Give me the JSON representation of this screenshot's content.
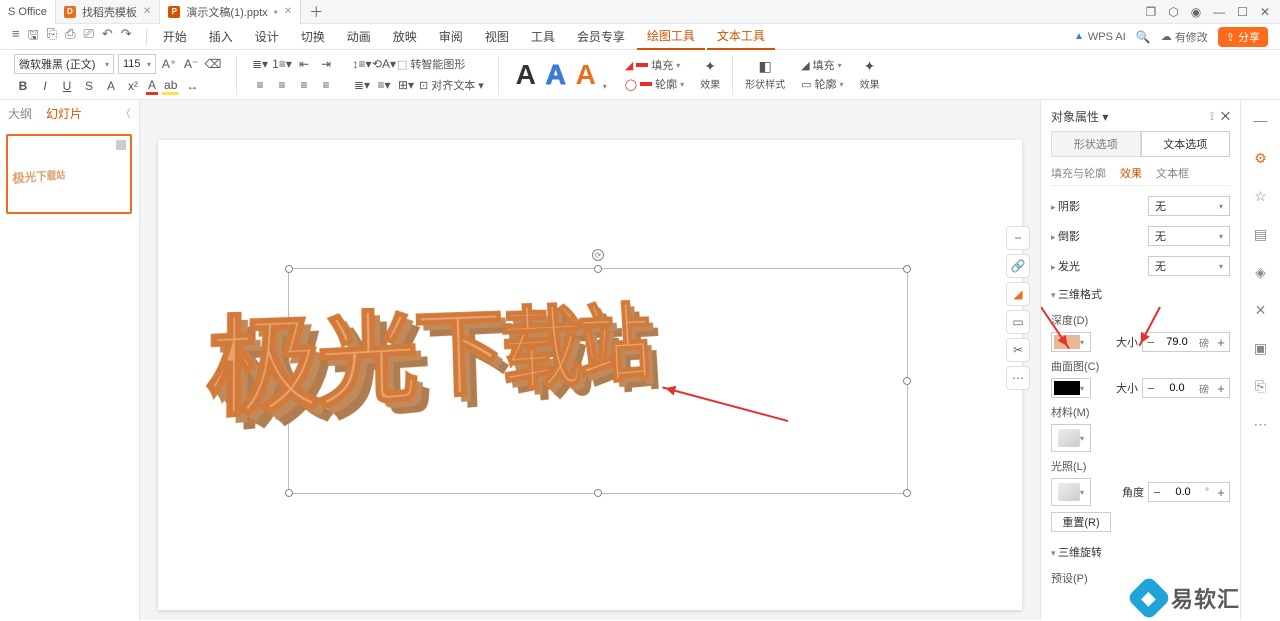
{
  "titlebar": {
    "office_tab": "S Office",
    "tab1": "找稻壳模板",
    "tab2": "演示文稿(1).pptx"
  },
  "window": {
    "changes": "有修改",
    "share": "分享"
  },
  "menus": [
    "开始",
    "插入",
    "设计",
    "切换",
    "动画",
    "放映",
    "审阅",
    "视图",
    "工具",
    "会员专享",
    "绘图工具",
    "文本工具"
  ],
  "wpsai": "WPS AI",
  "ribbon": {
    "font": "微软雅黑 (正文)",
    "size": "115",
    "convert": "转智能图形",
    "fit": "对齐文本",
    "fill": "填充",
    "outline": "轮廓",
    "effect": "效果",
    "shapestyle": "形状样式",
    "sfill": "填充",
    "soutline": "轮廓",
    "seffect": "效果"
  },
  "leftpanel": {
    "tab1": "大纲",
    "tab2": "幻灯片",
    "thumb_text": "极光下载站"
  },
  "canvas": {
    "text": "极光下载站"
  },
  "rightpanel": {
    "title": "对象属性",
    "tab_shape": "形状选项",
    "tab_text": "文本选项",
    "sub_fill": "填充与轮廓",
    "sub_effect": "效果",
    "sub_textbox": "文本框",
    "shadow": "阴影",
    "reflection": "倒影",
    "glow": "发光",
    "none": "无",
    "threed_header": "三维格式",
    "depth": "深度(D)",
    "size_label": "大小",
    "depth_value": "79.0",
    "depth_unit": "磅",
    "contour": "曲面图(C)",
    "contour_value": "0.0",
    "contour_unit": "磅",
    "material": "材料(M)",
    "lighting": "光照(L)",
    "angle": "角度",
    "angle_value": "0.0",
    "angle_unit": "°",
    "reset": "重置(R)",
    "rotation_header": "三维旋转",
    "preset": "预设(P)",
    "depth_color": "#e8b896",
    "contour_color": "#000000"
  },
  "watermark": "易软汇"
}
